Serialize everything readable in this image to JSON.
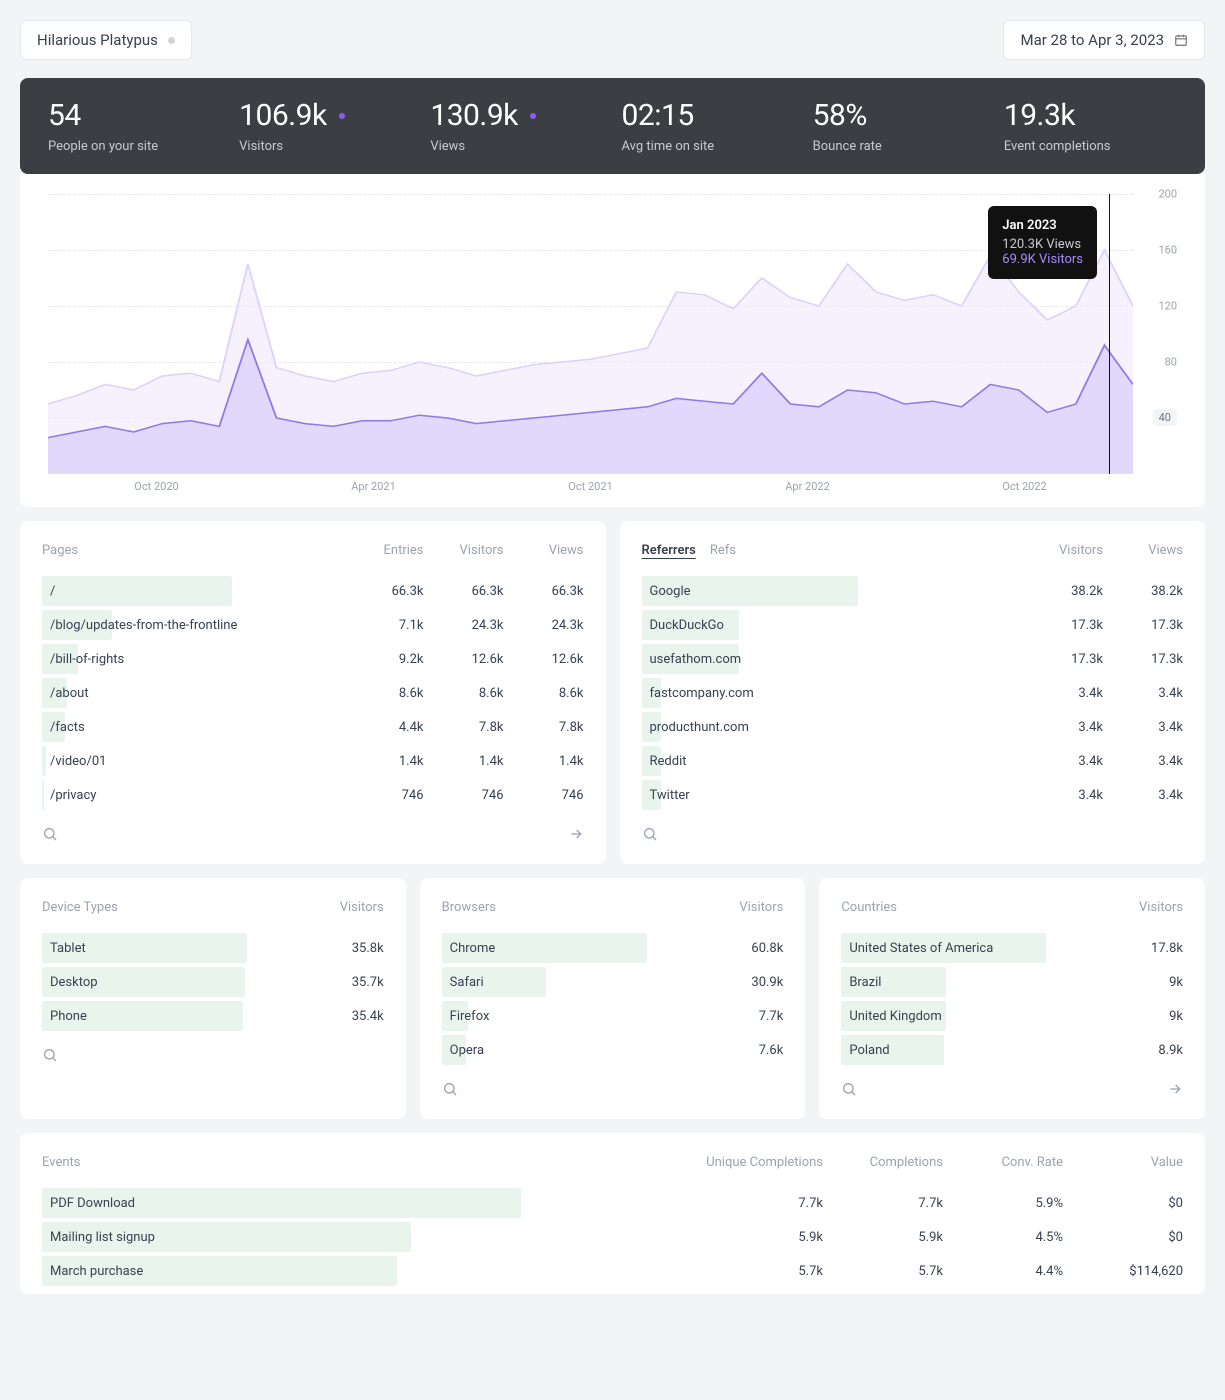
{
  "header": {
    "site_name": "Hilarious Platypus",
    "date_range": "Mar 28 to Apr 3, 2023"
  },
  "metrics": [
    {
      "value": "54",
      "label": "People on your site",
      "dot": false
    },
    {
      "value": "106.9k",
      "label": "Visitors",
      "dot": true
    },
    {
      "value": "130.9k",
      "label": "Views",
      "dot": true
    },
    {
      "value": "02:15",
      "label": "Avg time on site",
      "dot": false
    },
    {
      "value": "58%",
      "label": "Bounce rate",
      "dot": false
    },
    {
      "value": "19.3k",
      "label": "Event completions",
      "dot": false
    }
  ],
  "chart_tooltip": {
    "title": "Jan 2023",
    "views": "120.3K Views",
    "visitors": "69.9K Visitors"
  },
  "chart_data": {
    "type": "area",
    "ylim": [
      0,
      200
    ],
    "yticks": [
      40,
      80,
      120,
      160,
      200
    ],
    "xticks": [
      "Oct 2020",
      "Apr 2021",
      "Oct 2021",
      "Apr 2022",
      "Oct 2022"
    ],
    "series": [
      {
        "name": "Views",
        "color": "#ede9fe",
        "values": [
          50,
          56,
          64,
          60,
          70,
          72,
          66,
          150,
          76,
          70,
          66,
          72,
          74,
          80,
          76,
          70,
          74,
          78,
          80,
          82,
          86,
          90,
          130,
          128,
          118,
          140,
          126,
          120,
          150,
          130,
          124,
          128,
          120,
          156,
          130,
          110,
          120,
          160,
          120
        ]
      },
      {
        "name": "Visitors",
        "color": "#c4b5fd",
        "values": [
          26,
          30,
          34,
          30,
          36,
          38,
          34,
          96,
          40,
          36,
          34,
          38,
          38,
          42,
          40,
          36,
          38,
          40,
          42,
          44,
          46,
          48,
          54,
          52,
          50,
          72,
          50,
          48,
          60,
          58,
          50,
          52,
          48,
          64,
          60,
          44,
          50,
          92,
          64
        ]
      }
    ]
  },
  "pages": {
    "title": "Pages",
    "cols": [
      "Entries",
      "Visitors",
      "Views"
    ],
    "rows": [
      {
        "label": "/",
        "vals": [
          "66.3k",
          "66.3k",
          "66.3k"
        ],
        "bar": 100
      },
      {
        "label": "/blog/updates-from-the-frontline",
        "vals": [
          "7.1k",
          "24.3k",
          "24.3k"
        ],
        "bar": 37
      },
      {
        "label": "/bill-of-rights",
        "vals": [
          "9.2k",
          "12.6k",
          "12.6k"
        ],
        "bar": 19
      },
      {
        "label": "/about",
        "vals": [
          "8.6k",
          "8.6k",
          "8.6k"
        ],
        "bar": 13
      },
      {
        "label": "/facts",
        "vals": [
          "4.4k",
          "7.8k",
          "7.8k"
        ],
        "bar": 12
      },
      {
        "label": "/video/01",
        "vals": [
          "1.4k",
          "1.4k",
          "1.4k"
        ],
        "bar": 2
      },
      {
        "label": "/privacy",
        "vals": [
          "746",
          "746",
          "746"
        ],
        "bar": 1
      }
    ]
  },
  "referrers": {
    "tabs": [
      "Referrers",
      "Refs"
    ],
    "cols": [
      "Visitors",
      "Views"
    ],
    "rows": [
      {
        "label": "Google",
        "vals": [
          "38.2k",
          "38.2k"
        ],
        "bar": 100
      },
      {
        "label": "DuckDuckGo",
        "vals": [
          "17.3k",
          "17.3k"
        ],
        "bar": 45
      },
      {
        "label": "usefathom.com",
        "vals": [
          "17.3k",
          "17.3k"
        ],
        "bar": 45
      },
      {
        "label": "fastcompany.com",
        "vals": [
          "3.4k",
          "3.4k"
        ],
        "bar": 9
      },
      {
        "label": "producthunt.com",
        "vals": [
          "3.4k",
          "3.4k"
        ],
        "bar": 9
      },
      {
        "label": "Reddit",
        "vals": [
          "3.4k",
          "3.4k"
        ],
        "bar": 9
      },
      {
        "label": "Twitter",
        "vals": [
          "3.4k",
          "3.4k"
        ],
        "bar": 9
      }
    ]
  },
  "devices": {
    "title": "Device Types",
    "col": "Visitors",
    "rows": [
      {
        "label": "Tablet",
        "val": "35.8k",
        "bar": 100
      },
      {
        "label": "Desktop",
        "val": "35.7k",
        "bar": 99
      },
      {
        "label": "Phone",
        "val": "35.4k",
        "bar": 98
      }
    ]
  },
  "browsers": {
    "title": "Browsers",
    "col": "Visitors",
    "rows": [
      {
        "label": "Chrome",
        "val": "60.8k",
        "bar": 100
      },
      {
        "label": "Safari",
        "val": "30.9k",
        "bar": 51
      },
      {
        "label": "Firefox",
        "val": "7.7k",
        "bar": 13
      },
      {
        "label": "Opera",
        "val": "7.6k",
        "bar": 12
      }
    ]
  },
  "countries": {
    "title": "Countries",
    "col": "Visitors",
    "rows": [
      {
        "label": "United States of America",
        "val": "17.8k",
        "bar": 100
      },
      {
        "label": "Brazil",
        "val": "9k",
        "bar": 51
      },
      {
        "label": "United Kingdom",
        "val": "9k",
        "bar": 51
      },
      {
        "label": "Poland",
        "val": "8.9k",
        "bar": 50
      }
    ]
  },
  "events": {
    "title": "Events",
    "cols": [
      "Unique Completions",
      "Completions",
      "Conv. Rate",
      "Value"
    ],
    "rows": [
      {
        "label": "PDF Download",
        "vals": [
          "7.7k",
          "7.7k",
          "5.9%",
          "$0"
        ],
        "bar": 100
      },
      {
        "label": "Mailing list signup",
        "vals": [
          "5.9k",
          "5.9k",
          "4.5%",
          "$0"
        ],
        "bar": 77
      },
      {
        "label": "March purchase",
        "vals": [
          "5.7k",
          "5.7k",
          "4.4%",
          "$114,620"
        ],
        "bar": 74
      }
    ]
  }
}
